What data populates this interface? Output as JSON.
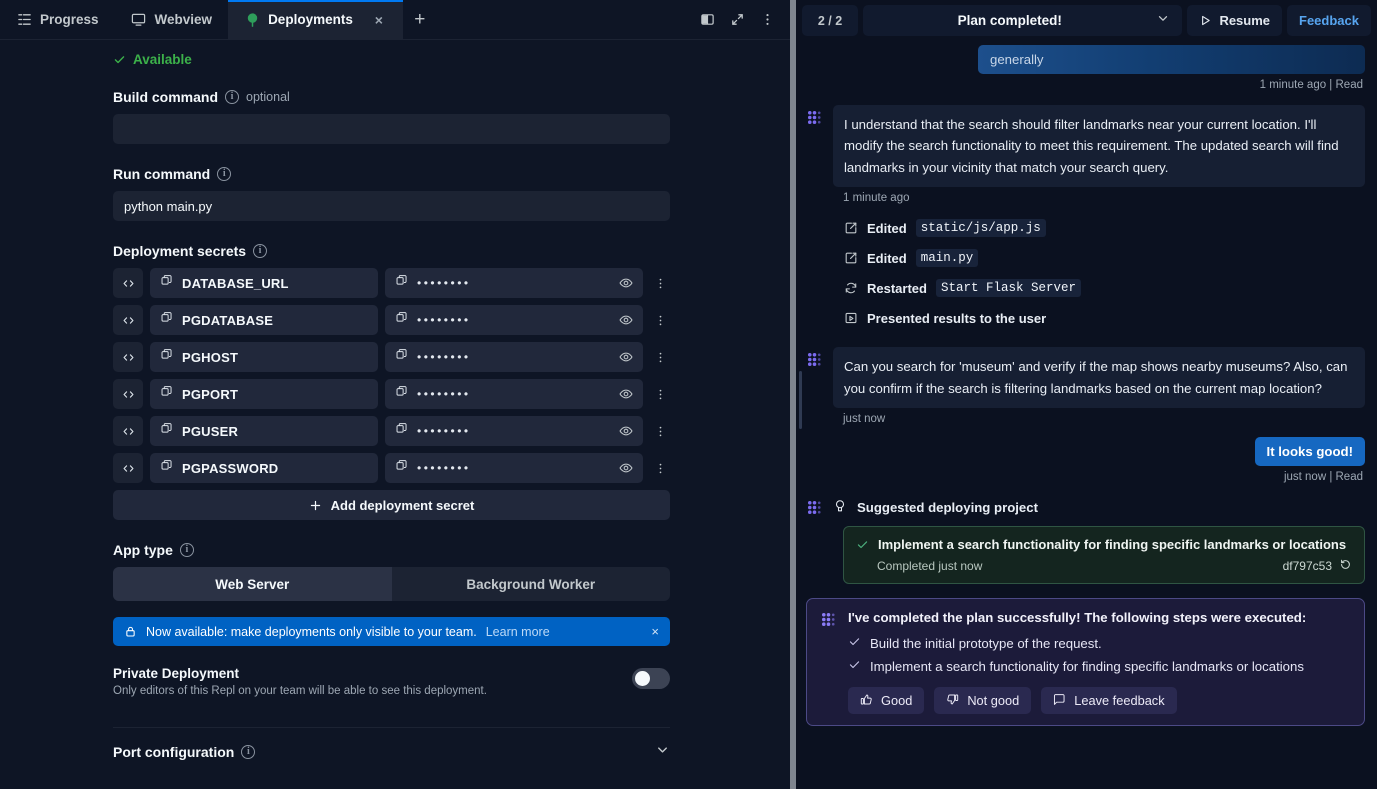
{
  "colors": {
    "accent_blue": "#0079f2",
    "banner_blue": "#0062c3",
    "user_bubble": "#1668c1",
    "success_green": "#3cb14a",
    "task_card_border": "#2f5543",
    "summary_border": "#4c4a86",
    "panel_bg": "#0e1525",
    "chat_bg": "#0b1120"
  },
  "tabs": [
    {
      "label": "Progress",
      "icon": "progress-icon",
      "active": false
    },
    {
      "label": "Webview",
      "icon": "monitor-icon",
      "active": false
    },
    {
      "label": "Deployments",
      "icon": "deployments-icon",
      "active": true
    }
  ],
  "tabbar": {
    "add_tab_label": "+",
    "close_label": "×",
    "actions": [
      {
        "name": "split-pane-icon"
      },
      {
        "name": "maximize-icon"
      },
      {
        "name": "overflow-menu-icon"
      }
    ]
  },
  "deployments": {
    "status": "Available",
    "build_command": {
      "label": "Build command",
      "optional_tag": "optional",
      "value": "",
      "placeholder": ""
    },
    "run_command": {
      "label": "Run command",
      "value": "python main.py"
    },
    "secrets": {
      "label": "Deployment secrets",
      "masked_value": "••••••••",
      "items": [
        {
          "key": "DATABASE_URL"
        },
        {
          "key": "PGDATABASE"
        },
        {
          "key": "PGHOST"
        },
        {
          "key": "PGPORT"
        },
        {
          "key": "PGUSER"
        },
        {
          "key": "PGPASSWORD"
        }
      ],
      "add_label": "Add deployment secret"
    },
    "app_type": {
      "label": "App type",
      "options": [
        "Web Server",
        "Background Worker"
      ],
      "selected": "Web Server"
    },
    "banner": {
      "text": "Now available: make deployments only visible to your team.",
      "link": "Learn more",
      "close": "×"
    },
    "private_deployment": {
      "title": "Private Deployment",
      "subtitle": "Only editors of this Repl on your team will be able to see this deployment.",
      "enabled": false
    },
    "port_configuration": {
      "label": "Port configuration"
    }
  },
  "agent": {
    "header": {
      "step_count": "2 / 2",
      "plan_status": "Plan completed!",
      "resume_label": "Resume",
      "feedback_label": "Feedback"
    },
    "messages": [
      {
        "type": "user_partial",
        "text": "generally",
        "meta": "1 minute ago | Read"
      },
      {
        "type": "ai",
        "text": "I understand that the search should filter landmarks near your current location. I'll modify the search functionality to meet this requirement. The updated search will find landmarks in your vicinity that match your search query.",
        "meta": "1 minute ago"
      }
    ],
    "actions": [
      {
        "icon": "edit-file-icon",
        "verb": "Edited",
        "target": "static/js/app.js"
      },
      {
        "icon": "edit-file-icon",
        "verb": "Edited",
        "target": "main.py"
      },
      {
        "icon": "restart-icon",
        "verb": "Restarted",
        "target": "Start Flask Server"
      },
      {
        "icon": "present-icon",
        "verb": "Presented results to the user",
        "target": ""
      }
    ],
    "followup": {
      "text": "Can you search for 'museum' and verify if the map shows nearby museums? Also, can you confirm if the search is filtering landmarks based on the current map location?",
      "meta": "just now"
    },
    "user_reply": {
      "text": "It looks good!",
      "meta": "just now | Read"
    },
    "suggestion": {
      "icon": "rocket-icon",
      "text": "Suggested deploying project"
    },
    "task_card": {
      "title": "Implement a search functionality for finding specific landmarks or locations",
      "status": "Completed just now",
      "commit": "df797c53",
      "rollback_icon": "rollback-icon"
    },
    "summary": {
      "title": "I've completed the plan successfully! The following steps were executed:",
      "steps": [
        "Build the initial prototype of the request.",
        "Implement a search functionality for finding specific landmarks or locations"
      ],
      "feedback_buttons": [
        {
          "label": "Good",
          "icon": "thumbs-up-icon"
        },
        {
          "label": "Not good",
          "icon": "thumbs-down-icon"
        },
        {
          "label": "Leave feedback",
          "icon": "comment-icon"
        }
      ]
    }
  }
}
